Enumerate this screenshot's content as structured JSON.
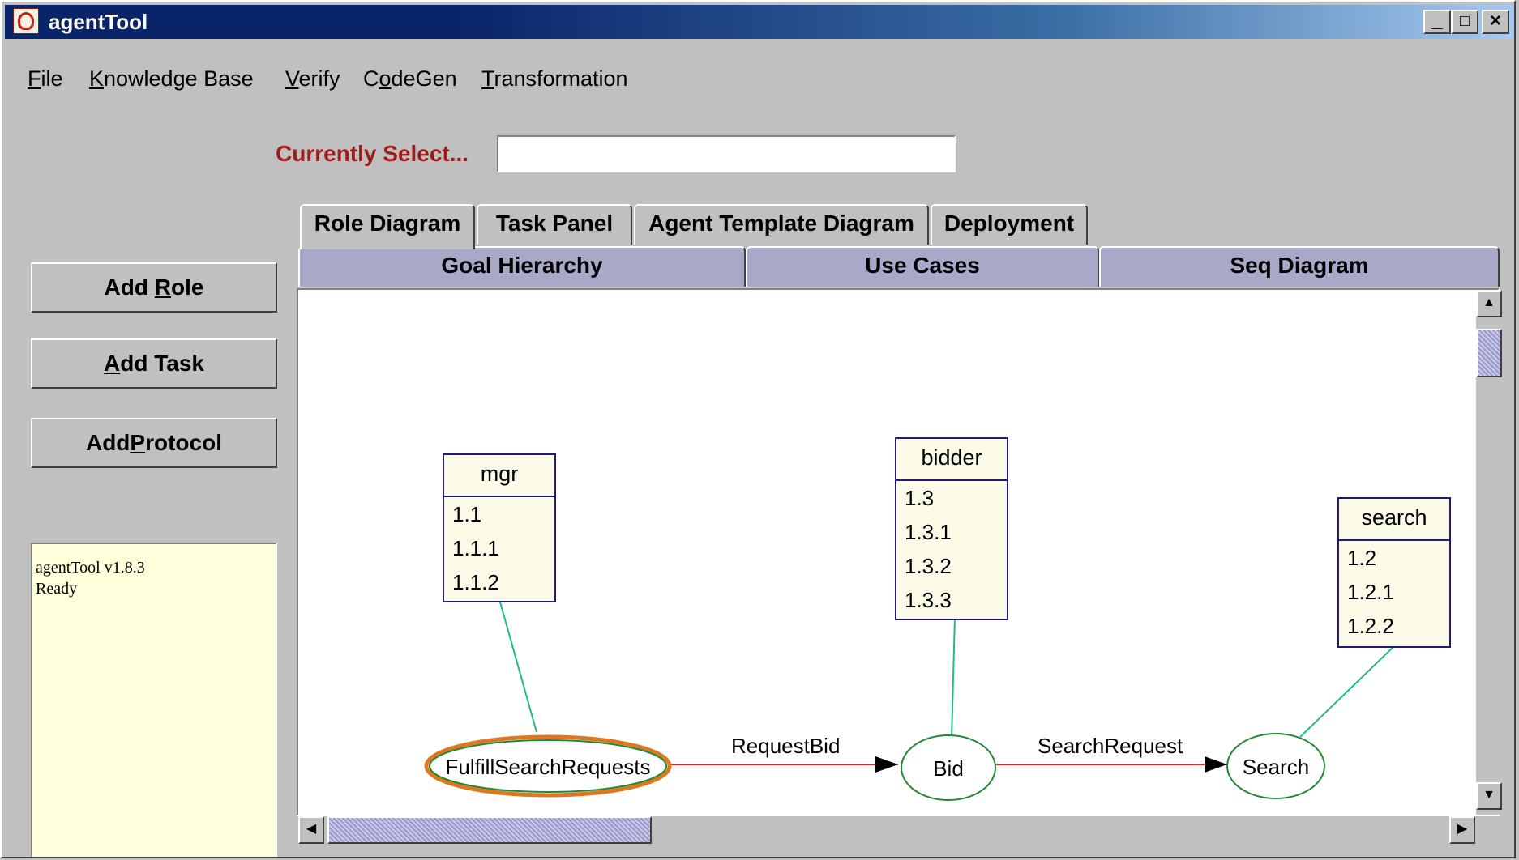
{
  "window": {
    "title": "agentTool",
    "min": "_",
    "max": "□",
    "close": "×"
  },
  "menu": [
    {
      "pre": "",
      "u": "F",
      "post": "ile"
    },
    {
      "pre": "",
      "u": "K",
      "post": "nowledge Base"
    },
    {
      "pre": "",
      "u": "V",
      "post": "erify"
    },
    {
      "pre": "C",
      "u": "o",
      "post": "deGen"
    },
    {
      "pre": "",
      "u": "T",
      "post": "ransformation"
    }
  ],
  "selection": {
    "label": "Currently Select...",
    "value": ""
  },
  "sidebar": {
    "add_role": {
      "pre": "Add ",
      "u": "R",
      "post": "ole"
    },
    "add_task": {
      "pre": "",
      "u": "A",
      "post": "dd Task"
    },
    "add_protocol": {
      "pre": "Add",
      "u": "P",
      "post": "rotocol"
    }
  },
  "log": {
    "line1": "agentTool v1.8.3",
    "line2": "Ready"
  },
  "tabs_front": [
    "Role Diagram",
    "Task Panel",
    "Agent Template Diagram",
    "Deployment"
  ],
  "tabs_back": [
    "Goal Hierarchy",
    "Use Cases",
    "Seq Diagram"
  ],
  "diagram": {
    "roles": [
      {
        "name": "mgr",
        "goals": [
          "1.1",
          "1.1.1",
          "1.1.2"
        ]
      },
      {
        "name": "bidder",
        "goals": [
          "1.3",
          "1.3.1",
          "1.3.2",
          "1.3.3"
        ]
      },
      {
        "name": "search",
        "goals": [
          "1.2",
          "1.2.1",
          "1.2.2"
        ]
      }
    ],
    "tasks": [
      "FulfillSearchRequests",
      "Bid",
      "Search"
    ],
    "protocols": [
      "RequestBid",
      "SearchRequest"
    ],
    "colors": {
      "task_edge": "#ee2222",
      "role_link": "#22bb88",
      "selected": "#dd7722",
      "task_border": "#228833",
      "role_border": "#1c1c78"
    }
  },
  "scrollbar": {
    "left": "◀",
    "right": "▶",
    "up": "▲",
    "down": "▼"
  }
}
